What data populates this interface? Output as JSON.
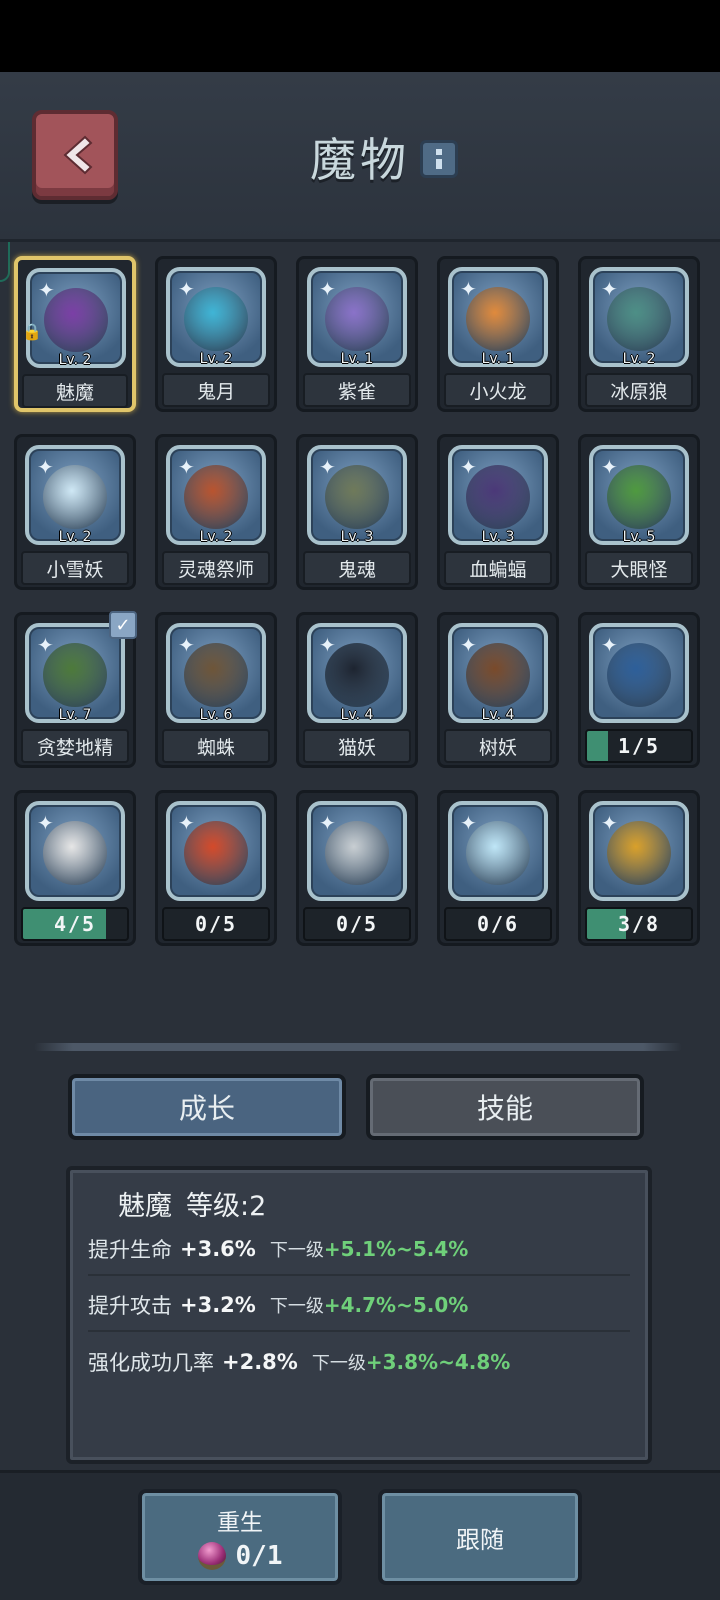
{
  "header": {
    "title": "魔物"
  },
  "monsters": [
    {
      "name": "魅魔",
      "level": "Lv. 2",
      "color": "#7b3fa6",
      "selected": true
    },
    {
      "name": "鬼月",
      "level": "Lv. 2",
      "color": "#3fb5d6"
    },
    {
      "name": "紫雀",
      "level": "Lv. 1",
      "color": "#8a72c9"
    },
    {
      "name": "小火龙",
      "level": "Lv. 1",
      "color": "#e08a3c"
    },
    {
      "name": "冰原狼",
      "level": "Lv. 2",
      "color": "#4d8f86"
    },
    {
      "name": "小雪妖",
      "level": "Lv. 2",
      "color": "#cfe8f5"
    },
    {
      "name": "灵魂祭师",
      "level": "Lv. 2",
      "color": "#b9542f"
    },
    {
      "name": "鬼魂",
      "level": "Lv. 3",
      "color": "#6f7a5a"
    },
    {
      "name": "血蝙蝠",
      "level": "Lv. 3",
      "color": "#4b3878"
    },
    {
      "name": "大眼怪",
      "level": "Lv. 5",
      "color": "#4f9a3f"
    },
    {
      "name": "贪婪地精",
      "level": "Lv. 7",
      "color": "#4d7a3a",
      "equipped": true
    },
    {
      "name": "蜘蛛",
      "level": "Lv. 6",
      "color": "#6e5538"
    },
    {
      "name": "猫妖",
      "level": "Lv. 4",
      "color": "#1d2430"
    },
    {
      "name": "树妖",
      "level": "Lv. 4",
      "color": "#7a4a2a"
    },
    {
      "progress": "1/5",
      "fill": 0.2,
      "color": "#2d5f9a"
    },
    {
      "progress": "4/5",
      "fill": 0.8,
      "color": "#e6e6e6"
    },
    {
      "progress": "0/5",
      "fill": 0,
      "color": "#d44a2a"
    },
    {
      "progress": "0/5",
      "fill": 0,
      "color": "#c8ced2"
    },
    {
      "progress": "0/6",
      "fill": 0,
      "color": "#bfe6f7"
    },
    {
      "progress": "3/8",
      "fill": 0.375,
      "color": "#d9a02a"
    }
  ],
  "tabs": {
    "growth": "成长",
    "skills": "技能"
  },
  "detail": {
    "name": "魅魔",
    "level_label": "等级:2",
    "stats": [
      {
        "label": "提升生命",
        "value": "+3.6%",
        "next_label": "下一级",
        "next_value": "+5.1%~5.4%"
      },
      {
        "label": "提升攻击",
        "value": "+3.2%",
        "next_label": "下一级",
        "next_value": "+4.7%~5.0%"
      },
      {
        "label": "强化成功几率",
        "value": "+2.8%",
        "next_label": "下一级",
        "next_value": "+3.8%~4.8%"
      }
    ]
  },
  "footer": {
    "rebirth_label": "重生",
    "rebirth_count": "0/1",
    "follow_label": "跟随"
  }
}
